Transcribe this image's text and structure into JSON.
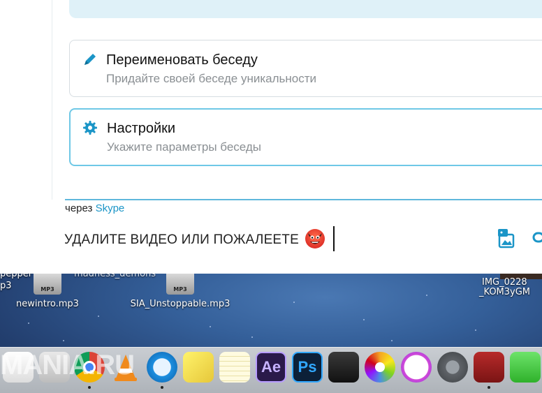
{
  "cards": [
    {
      "title": "Переименовать беседу",
      "subtitle": "Придайте своей беседе уникальности",
      "icon": "pencil-icon"
    },
    {
      "title": "Настройки",
      "subtitle": "Укажите параметры беседы",
      "icon": "gear-icon"
    }
  ],
  "composer": {
    "via_prefix": "через",
    "via_service": "Skype",
    "message_text": "УДАЛИТЕ ВИДЕО ИЛИ ПОЖАЛЕЕТЕ",
    "emoji": "devil-emoji"
  },
  "desktop": {
    "files": [
      {
        "name": "newintro.mp3",
        "badge": "MP3"
      },
      {
        "name": "SIA_Unstoppable.mp3",
        "badge": "MP3"
      }
    ],
    "partial_left_top": "pepper",
    "partial_left_bottom": "p3",
    "partial_middle": "madness_demons",
    "partial_right_top": "IMG_0228",
    "partial_right_bottom": "_KOM3yGM"
  },
  "dock": {
    "apps": [
      "Reminders",
      "Mail",
      "Chrome",
      "VLC",
      "QuickTime",
      "Stickies",
      "Notes",
      "After Effects",
      "Photoshop",
      "Final Cut Pro",
      "Photos",
      "iTunes",
      "System Preferences",
      "Photo Booth",
      "FaceTime"
    ],
    "ae_label": "Ae",
    "ps_label": "Ps"
  },
  "watermark": "MANIA.RU",
  "colors": {
    "accent": "#1b95c7",
    "selected_border": "#6fc8e6",
    "top_box": "#dff1f8"
  }
}
